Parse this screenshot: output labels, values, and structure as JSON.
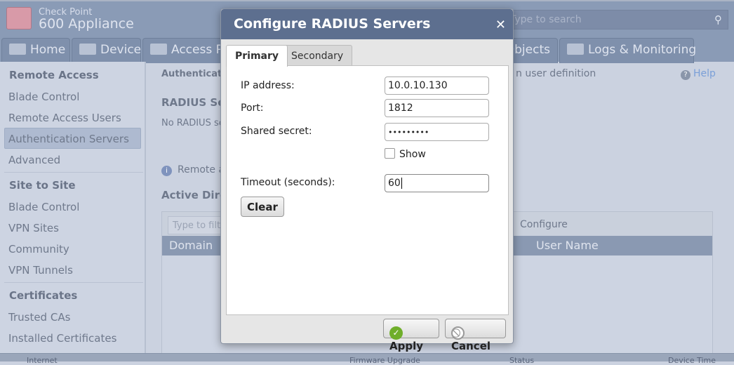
{
  "header": {
    "brand_line1": "Check Point",
    "brand_line2": "600 Appliance",
    "search_placeholder": "Type to search"
  },
  "nav_tabs": [
    {
      "label": "Home",
      "icon": "house-icon"
    },
    {
      "label": "Device",
      "icon": "device-icon"
    },
    {
      "label": "Access Policy",
      "icon": "access-policy-icon"
    },
    {
      "label": "Users & Objects",
      "icon": "users-objects-icon"
    },
    {
      "label": "Logs & Monitoring",
      "icon": "logs-icon"
    }
  ],
  "sidebar": {
    "sections": [
      {
        "title": "Remote Access",
        "items": [
          "Blade Control",
          "Remote Access Users",
          "Authentication Servers",
          "Advanced"
        ]
      },
      {
        "title": "Site to Site",
        "items": [
          "Blade Control",
          "VPN Sites",
          "Community",
          "VPN Tunnels"
        ]
      },
      {
        "title": "Certificates",
        "items": [
          "Trusted CAs",
          "Installed Certificates"
        ]
      }
    ],
    "selected": "Authentication Servers"
  },
  "main": {
    "breadcrumb": "Authentication Servers",
    "intro_tail": "n user definition",
    "help": "Help",
    "radius_title": "RADIUS Servers",
    "radius_text": "No RADIUS servers",
    "info_text": "Remote access",
    "ad_title": "Active Directory",
    "filter_placeholder": "Type to filter",
    "configure": "Configure",
    "columns": [
      "Domain",
      "User Name"
    ]
  },
  "status_bar": [
    "Internet",
    "Firmware Upgrade",
    "Status",
    "Device Time"
  ],
  "dialog": {
    "title": "Configure RADIUS Servers",
    "tabs": [
      "Primary",
      "Secondary"
    ],
    "active_tab": "Primary",
    "fields": {
      "ip_label": "IP address:",
      "ip_value": "10.0.10.130",
      "port_label": "Port:",
      "port_value": "1812",
      "secret_label": "Shared secret:",
      "secret_value": "•••••••••",
      "show_label": "Show",
      "show_checked": false,
      "timeout_label": "Timeout (seconds):",
      "timeout_value": "60"
    },
    "clear": "Clear",
    "apply": "Apply",
    "cancel": "Cancel"
  }
}
